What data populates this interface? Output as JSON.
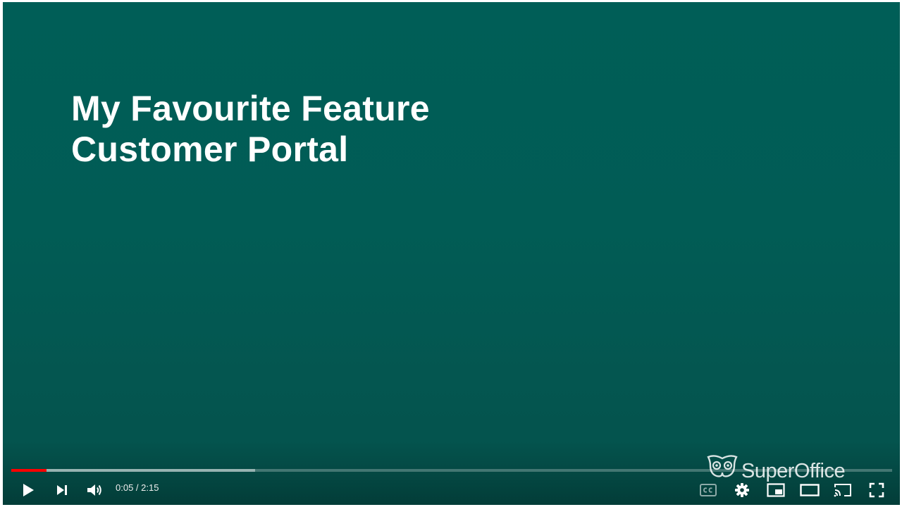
{
  "video": {
    "title_line1": "My Favourite Feature",
    "title_line2": "Customer Portal",
    "logo_text": "SuperOffice"
  },
  "player": {
    "current_time": "0:05",
    "separator": " / ",
    "duration": "2:15",
    "played_fraction": 0.04,
    "buffered_fraction": 0.277,
    "colors": {
      "progress_played": "#ff0000",
      "background_teal": "#005e57"
    },
    "icons": [
      "play-icon",
      "next-icon",
      "volume-icon",
      "subtitles-icon",
      "settings-icon",
      "miniplayer-icon",
      "theater-mode-icon",
      "cast-icon",
      "fullscreen-icon"
    ]
  }
}
